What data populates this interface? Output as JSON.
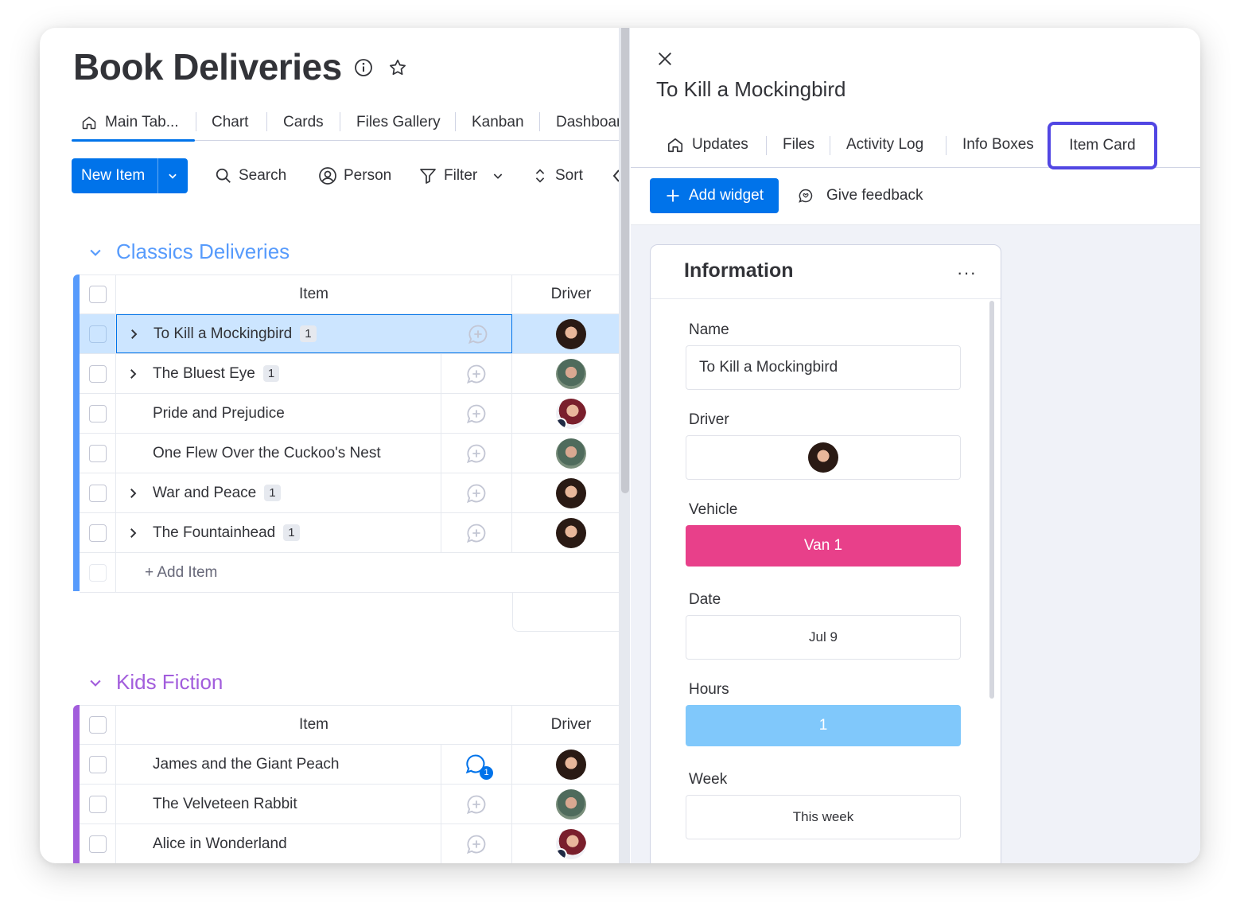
{
  "board": {
    "title": "Book Deliveries",
    "views": [
      {
        "label": "Main Tab..."
      },
      {
        "label": "Chart"
      },
      {
        "label": "Cards"
      },
      {
        "label": "Files Gallery"
      },
      {
        "label": "Kanban"
      },
      {
        "label": "Dashboar"
      }
    ],
    "toolbar": {
      "new_item": "New Item",
      "search": "Search",
      "person": "Person",
      "filter": "Filter",
      "sort": "Sort"
    },
    "groups": [
      {
        "name": "Classics Deliveries",
        "color": "#579bfc",
        "columns": {
          "item": "Item",
          "driver": "Driver"
        },
        "rows": [
          {
            "name": "To Kill a Mockingbird",
            "count": "1",
            "avatar": "dark"
          },
          {
            "name": "The Bluest Eye",
            "count": "1",
            "avatar": "teal"
          },
          {
            "name": "Pride and Prejudice",
            "count": "",
            "avatar": "red"
          },
          {
            "name": "One Flew Over the Cuckoo's Nest",
            "count": "",
            "avatar": "teal"
          },
          {
            "name": "War and Peace",
            "count": "1",
            "avatar": "dark"
          },
          {
            "name": "The Fountainhead",
            "count": "1",
            "avatar": "dark"
          }
        ],
        "add_item": "+ Add Item"
      },
      {
        "name": "Kids Fiction",
        "color": "#a25ddc",
        "columns": {
          "item": "Item",
          "driver": "Driver"
        },
        "rows": [
          {
            "name": "James and the Giant Peach",
            "count": "",
            "avatar": "dark",
            "updates": "1"
          },
          {
            "name": "The Velveteen Rabbit",
            "count": "",
            "avatar": "teal"
          },
          {
            "name": "Alice in Wonderland",
            "count": "",
            "avatar": "red"
          }
        ]
      }
    ]
  },
  "panel": {
    "title": "To Kill a Mockingbird",
    "tabs": [
      {
        "label": "Updates"
      },
      {
        "label": "Files"
      },
      {
        "label": "Activity Log"
      },
      {
        "label": "Info Boxes"
      },
      {
        "label": "Item Card"
      }
    ],
    "add_widget": "Add widget",
    "give_feedback": "Give feedback",
    "widget": {
      "title": "Information",
      "more": "···",
      "fields": {
        "name_label": "Name",
        "name_value": "To Kill a Mockingbird",
        "driver_label": "Driver",
        "vehicle_label": "Vehicle",
        "vehicle_value": "Van 1",
        "vehicle_color": "#e8408a",
        "date_label": "Date",
        "date_value": "Jul 9",
        "hours_label": "Hours",
        "hours_value": "1",
        "hours_color": "#80c8fb",
        "week_label": "Week",
        "week_value": "This week"
      }
    }
  },
  "colors": {
    "primary": "#0073ea",
    "selected_row": "#cce5ff",
    "highlight_outline": "#5146e3"
  }
}
